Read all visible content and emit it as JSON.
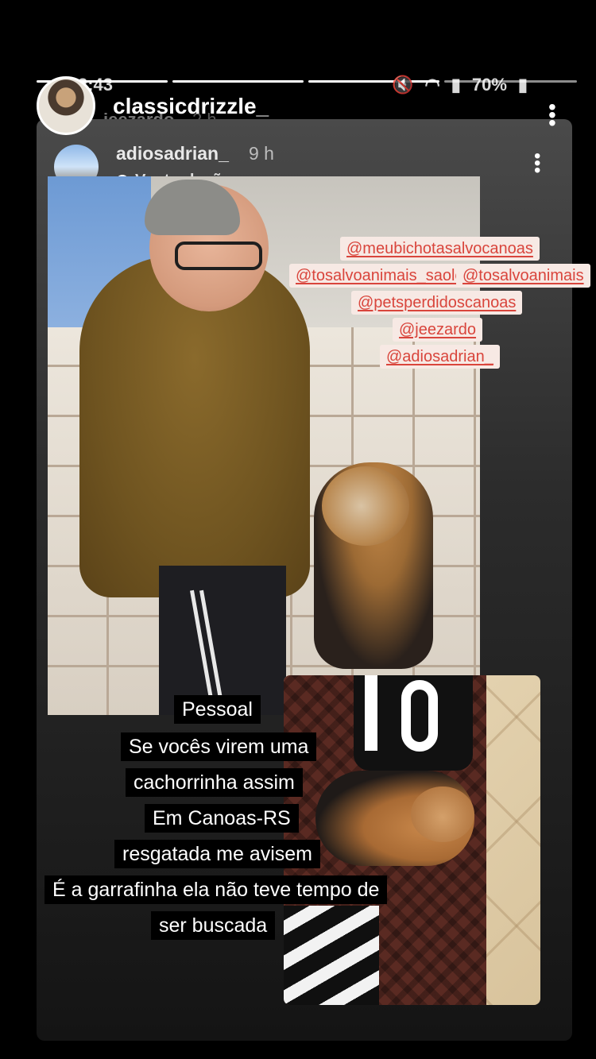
{
  "status_bar": {
    "time": "2:43",
    "battery": "70%"
  },
  "outer_story": {
    "username": "classicdrizzle_",
    "underlying_username": "jeezardo",
    "underlying_time": "2 h"
  },
  "shared_story": {
    "username": "adiosadrian_",
    "time": "9 h",
    "translate_label": "Ver tradução",
    "tags": [
      "@meubichotasalvocanoas",
      "@tosalvoanimais_saoleo",
      "@tosalvoanimais",
      "@petsperdidoscanoas",
      "@jeezardo",
      "@adiosadrian_"
    ],
    "caption_lines": [
      "Pessoal",
      "Se vocês virem uma",
      "cachorrinha assim",
      "Em Canoas-RS",
      "resgatada me avisem",
      "É a garrafinha ela não teve tempo de",
      "ser buscada"
    ]
  }
}
